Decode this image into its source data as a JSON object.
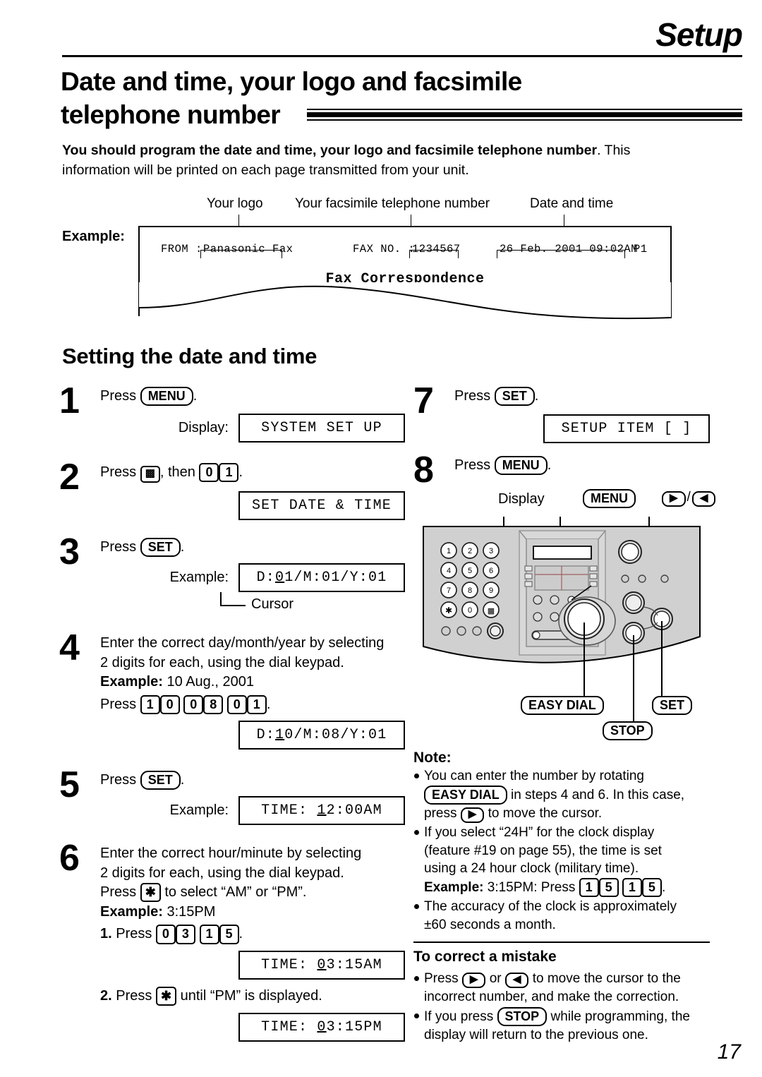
{
  "header": {
    "chapter": "Setup",
    "title_line1": "Date and time, your logo and facsimile",
    "title_line2": "telephone number"
  },
  "intro": {
    "bold": "You should program the date and time, your logo and facsimile telephone number",
    "rest": ". This information will be printed on each page transmitted from your unit."
  },
  "example_block": {
    "label": "Example:",
    "callouts": {
      "logo": "Your logo",
      "fax_number": "Your facsimile telephone number",
      "date_time": "Date and time"
    },
    "fax_header": {
      "from_label": "FROM :",
      "logo_value": "Panasonic Fax",
      "faxno_label": "FAX NO. :",
      "faxno_value": "1234567",
      "datetime_value": "26 Feb. 2001 09:02AM",
      "page_value": "P1",
      "subject": "Fax Correspondence"
    }
  },
  "section": {
    "heading": "Setting the date and time"
  },
  "steps": {
    "s1": {
      "num": "1",
      "press_word": "Press",
      "key": "MENU",
      "period": ".",
      "display_caption": "Display:",
      "lcd": "SYSTEM SET UP"
    },
    "s2": {
      "num": "2",
      "press_word": "Press",
      "key_hash": "#",
      "then_word": ", then",
      "key_0": "0",
      "key_1": "1",
      "period": ".",
      "lcd": "SET DATE & TIME"
    },
    "s3": {
      "num": "3",
      "press_word": "Press",
      "key": "SET",
      "period": ".",
      "example_caption": "Example:",
      "lcd_pre": "D:",
      "lcd_cursor": "0",
      "lcd_post": "1/M:01/Y:01",
      "cursor_label": "Cursor"
    },
    "s4": {
      "num": "4",
      "text_line1": "Enter the correct day/month/year by selecting",
      "text_line2": "2 digits for each, using the dial keypad.",
      "example_label": "Example:",
      "example_value": "10 Aug., 2001",
      "press_word": "Press",
      "keys": [
        "1",
        "0",
        "0",
        "8",
        "0",
        "1"
      ],
      "period": ".",
      "lcd_pre": "D:",
      "lcd_cursor": "1",
      "lcd_post": "0/M:08/Y:01"
    },
    "s5": {
      "num": "5",
      "press_word": "Press",
      "key": "SET",
      "period": ".",
      "example_caption": "Example:",
      "lcd_pre": "TIME:   ",
      "lcd_cursor": "1",
      "lcd_post": "2:00AM"
    },
    "s6": {
      "num": "6",
      "text_line1": "Enter the correct hour/minute by selecting",
      "text_line2": "2 digits for each, using the dial keypad.",
      "press_word": "Press",
      "key_star": "✱",
      "text_line3": "to select “AM” or “PM”.",
      "example_label": "Example:",
      "example_value": "3:15PM",
      "sub1_num": "1.",
      "sub1_press": "Press",
      "sub1_keys": [
        "0",
        "3",
        "1",
        "5"
      ],
      "sub1_period": ".",
      "lcd1_pre": "TIME:   ",
      "lcd1_cursor": "0",
      "lcd1_post": "3:15AM",
      "sub2_num": "2.",
      "sub2_press": "Press",
      "sub2_key_star": "✱",
      "sub2_text": "until “PM” is displayed.",
      "lcd2_pre": "TIME:   ",
      "lcd2_cursor": "0",
      "lcd2_post": "3:15PM"
    },
    "s7": {
      "num": "7",
      "press_word": "Press",
      "key": "SET",
      "period": ".",
      "lcd": "SETUP ITEM [  ]"
    },
    "s8": {
      "num": "8",
      "press_word": "Press",
      "key": "MENU",
      "period": "."
    }
  },
  "diagram": {
    "label_display": "Display",
    "label_menu": "MENU",
    "label_right_arrow": "▶",
    "label_slash": "/",
    "label_left_arrow": "◀",
    "label_easy_dial": "EASY DIAL",
    "label_set": "SET",
    "label_stop": "STOP",
    "keypad": [
      "1",
      "2",
      "3",
      "4",
      "5",
      "6",
      "7",
      "8",
      "9",
      "✱",
      "0",
      "#"
    ]
  },
  "note": {
    "title": "Note:",
    "items": [
      {
        "seg1": "You can enter the number by rotating",
        "key": "EASY DIAL",
        "seg2": "in steps 4 and 6. In this case,",
        "seg3": "press",
        "key2": "▶",
        "seg4": "to move the cursor."
      },
      {
        "seg1": "If you select “24H” for the clock display",
        "seg2": "(feature #19 on page 55), the time is set",
        "seg3": "using a 24 hour clock (military time).",
        "example_label": "Example:",
        "example_text": "3:15PM: Press",
        "keys": [
          "1",
          "5",
          "1",
          "5"
        ],
        "period": "."
      },
      {
        "seg1": "The accuracy of the clock is approximately",
        "seg2": "±60 seconds a month."
      }
    ]
  },
  "correct_mistake": {
    "title": "To correct a mistake",
    "items": [
      {
        "seg1": "Press",
        "key1": "▶",
        "seg2": "or",
        "key2": "◀",
        "seg3": "to move the cursor to the",
        "seg4": "incorrect number, and make the correction."
      },
      {
        "seg1": "If you press",
        "key1": "STOP",
        "seg2": "while programming, the",
        "seg3": "display will return to the previous one."
      }
    ]
  },
  "page_number": "17"
}
